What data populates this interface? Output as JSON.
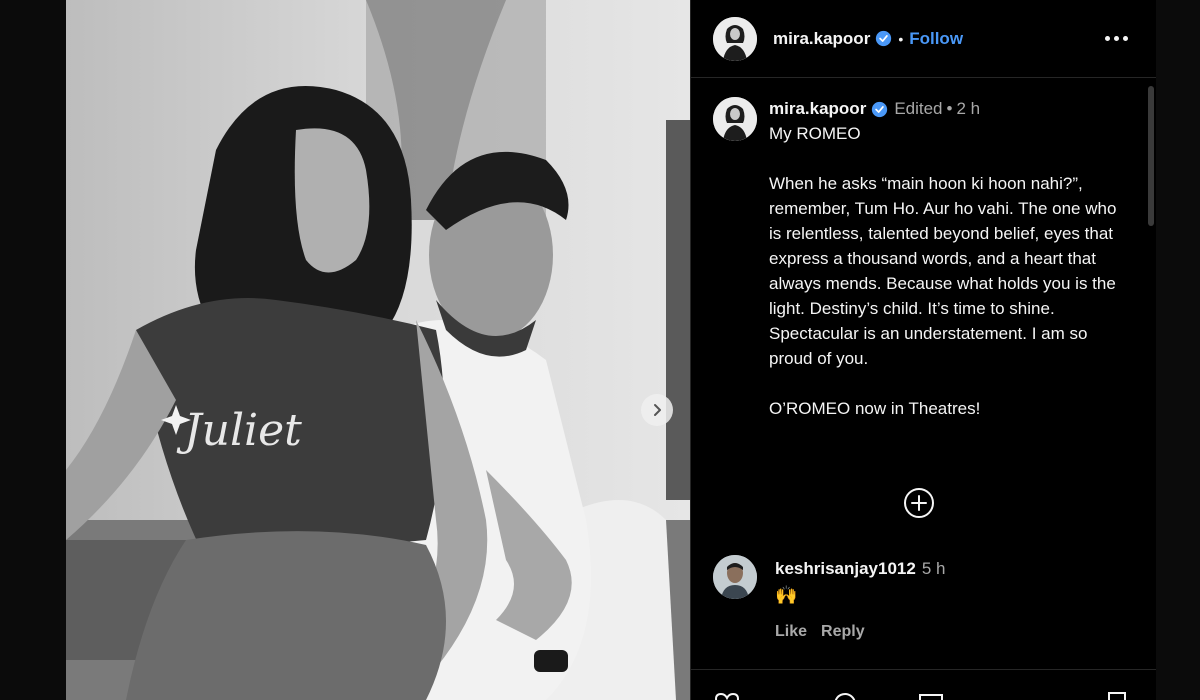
{
  "post": {
    "username": "mira.kapoor",
    "follow_label": "Follow",
    "separator": "•",
    "photo_shirt_text": "Juliet"
  },
  "caption": {
    "username": "mira.kapoor",
    "edited_label": "Edited",
    "separator": "•",
    "time": "2 h",
    "title": "My ROMEO",
    "paragraph1": "When he asks “main hoon ki hoon nahi?”, remember, Tum Ho. Aur ho vahi. The one who is relentless, talented beyond belief, eyes that express a thousand words, and a heart that always mends. Because what holds you is the light. Destiny’s child. It’s time to shine.",
    "paragraph2": "Spectacular is an understatement. I am so proud of you.",
    "paragraph3": "O’ROMEO now in Theatres!"
  },
  "comment": {
    "username": "keshrisanjay1012",
    "time": "5 h",
    "text": "🙌",
    "like_label": "Like",
    "reply_label": "Reply"
  },
  "footer": {
    "icons": [
      "heart-icon",
      "comment-icon",
      "share-icon",
      "bookmark-icon"
    ]
  },
  "colors": {
    "accent": "#4a98f7",
    "verified": "#4a98f7",
    "muted": "#a8a8a8",
    "panel_bg": "#000000"
  }
}
